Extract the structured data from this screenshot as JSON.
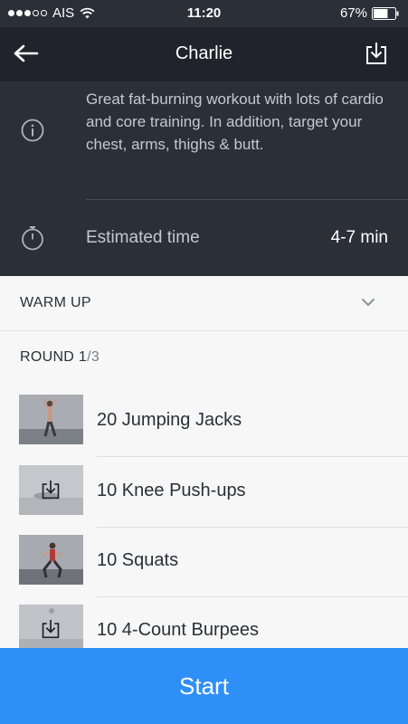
{
  "status_bar": {
    "carrier": "AIS",
    "time": "11:20",
    "battery": "67%",
    "battery_level": 0.67
  },
  "header": {
    "title": "Charlie"
  },
  "workout": {
    "description": "Great fat-burning workout with lots of cardio and core training. In addition, target your chest, arms, thighs & butt.",
    "time_label": "Estimated time",
    "time_value": "4-7 min"
  },
  "sections": {
    "warmup_label": "WARM UP",
    "round_prefix": "ROUND 1",
    "round_suffix": "/3"
  },
  "exercises": [
    {
      "label": "20 Jumping Jacks",
      "thumbnail": "jumping-jacks-photo",
      "downloaded": true
    },
    {
      "label": "10 Knee Push-ups",
      "thumbnail": "download-icon",
      "downloaded": false
    },
    {
      "label": "10 Squats",
      "thumbnail": "squats-photo",
      "downloaded": true
    },
    {
      "label": "10 4-Count Burpees",
      "thumbnail": "download-icon",
      "downloaded": false
    }
  ],
  "footer": {
    "start_label": "Start"
  },
  "colors": {
    "header_bg": "#2b2f38",
    "nav_bg": "#20232b",
    "accent": "#2e8ff6",
    "list_bg": "#f7f7f8"
  }
}
